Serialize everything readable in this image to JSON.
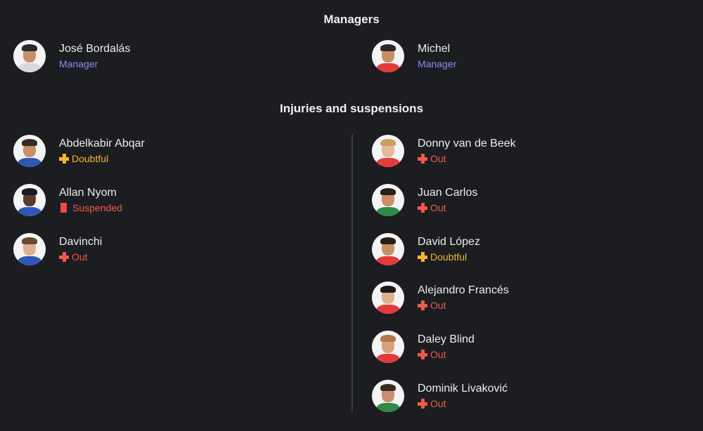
{
  "managers": {
    "title": "Managers",
    "items": [
      {
        "name": "José Bordalás",
        "role": "Manager"
      },
      {
        "name": "Michel",
        "role": "Manager"
      }
    ]
  },
  "injuries": {
    "title": "Injuries and suspensions",
    "left": [
      {
        "name": "Abdelkabir Abqar",
        "status": "Doubtful",
        "type": "doubtful"
      },
      {
        "name": "Allan Nyom",
        "status": "Suspended",
        "type": "suspended"
      },
      {
        "name": "Davinchi",
        "status": "Out",
        "type": "out"
      }
    ],
    "right": [
      {
        "name": "Donny van de Beek",
        "status": "Out",
        "type": "out"
      },
      {
        "name": "Juan Carlos",
        "status": "Out",
        "type": "out"
      },
      {
        "name": "David López",
        "status": "Doubtful",
        "type": "doubtful"
      },
      {
        "name": "Alejandro Francés",
        "status": "Out",
        "type": "out"
      },
      {
        "name": "Daley Blind",
        "status": "Out",
        "type": "out"
      },
      {
        "name": "Dominik Livaković",
        "status": "Out",
        "type": "out"
      }
    ]
  },
  "colors": {
    "background": "#1b1d20",
    "manager_role": "#8b8cf7",
    "doubtful": "#f3b534",
    "out": "#f05a4a",
    "suspended": "#f04848"
  },
  "icons": {
    "doubtful": "plus-icon",
    "out": "plus-icon",
    "suspended": "red-card-icon"
  }
}
